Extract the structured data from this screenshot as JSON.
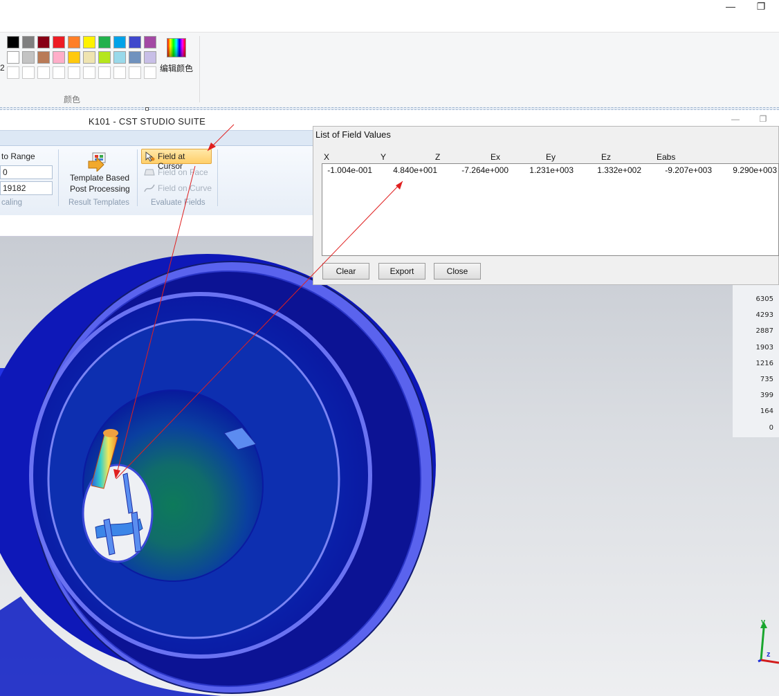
{
  "paint": {
    "window_controls": {
      "minimize_glyph": "—",
      "restore_glyph": "❐"
    },
    "size_digit": "2",
    "colors_group_label": "颜色",
    "edit_colors_label": "编辑颜色",
    "palette_row1": [
      "#000000",
      "#7f7f7f",
      "#880015",
      "#ed1c24",
      "#ff7f27",
      "#fff200",
      "#22b14c",
      "#00a2e8",
      "#3f48cc",
      "#a349a4"
    ],
    "palette_row2": [
      "#ffffff",
      "#c3c3c3",
      "#b97a57",
      "#ffaec9",
      "#ffc90e",
      "#efe4b0",
      "#b5e61d",
      "#99d9ea",
      "#7092be",
      "#c8bfe7"
    ]
  },
  "cst": {
    "window_title": "K101 - CST STUDIO SUITE",
    "ribbon": {
      "fit_to_range_label": "to Range",
      "range_min_value": "0",
      "range_max_value": "19182",
      "scaling_group_label": "caling",
      "template_button_label_line1": "Template Based",
      "template_button_label_line2": "Post Processing",
      "result_templates_group_label": "Result Templates",
      "field_at_cursor_label": "Field at Cursor",
      "field_on_face_label": "Field on Face",
      "field_on_curve_label": "Field on Curve",
      "evaluate_fields_group_label": "Evaluate Fields"
    },
    "legend_values": [
      "6305",
      "4293",
      "2887",
      "1903",
      "1216",
      "735",
      "399",
      "164",
      "0"
    ],
    "axis_label_y": "y",
    "axis_label_z": "z"
  },
  "field_dialog": {
    "title": "List of Field Values",
    "columns": [
      "X",
      "Y",
      "Z",
      "Ex",
      "Ey",
      "Ez",
      "Eabs"
    ],
    "rows": [
      [
        "-1.004e-001",
        "4.840e+001",
        "-7.264e+000",
        "1.231e+003",
        "1.332e+002",
        "-9.207e+003",
        "9.290e+003"
      ]
    ],
    "buttons": {
      "clear": "Clear",
      "export": "Export",
      "close": "Close"
    }
  },
  "colors": {
    "annotation_arrow": "#e02020",
    "highlight_button": "#ffd27a",
    "mesh_deep_blue": "#0a14a8",
    "mesh_light_blue": "#5b66f2"
  }
}
